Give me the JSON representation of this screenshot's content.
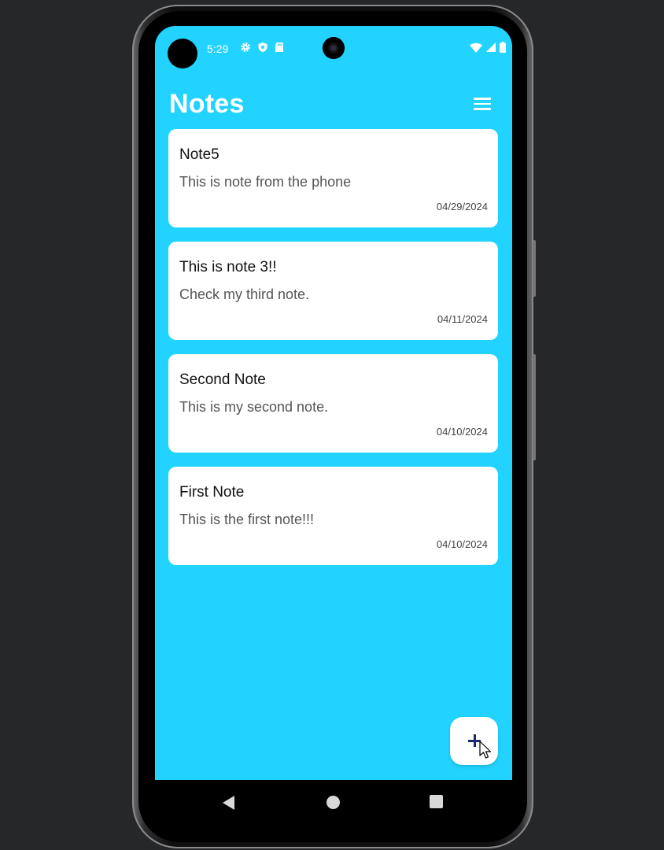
{
  "status_bar": {
    "time": "5:29",
    "left_icons": [
      "gear-icon",
      "shield-icon",
      "sd-card-icon"
    ],
    "right_icons": [
      "wifi-icon",
      "cell-signal-icon",
      "battery-icon"
    ]
  },
  "app": {
    "title": "Notes",
    "menu_icon": "menu-icon",
    "background_color": "#23d3ff"
  },
  "notes": [
    {
      "title": "Note5",
      "body": "This is note from the phone",
      "date": "04/29/2024"
    },
    {
      "title": "This is note 3!!",
      "body": "Check my third note.",
      "date": "04/11/2024"
    },
    {
      "title": "Second Note",
      "body": "This is my second note.",
      "date": "04/10/2024"
    },
    {
      "title": "First Note",
      "body": "This is the first note!!!",
      "date": "04/10/2024"
    }
  ],
  "fab": {
    "icon": "plus-icon"
  },
  "nav_bar": {
    "icons": [
      "back-icon",
      "home-icon",
      "recents-icon"
    ]
  }
}
